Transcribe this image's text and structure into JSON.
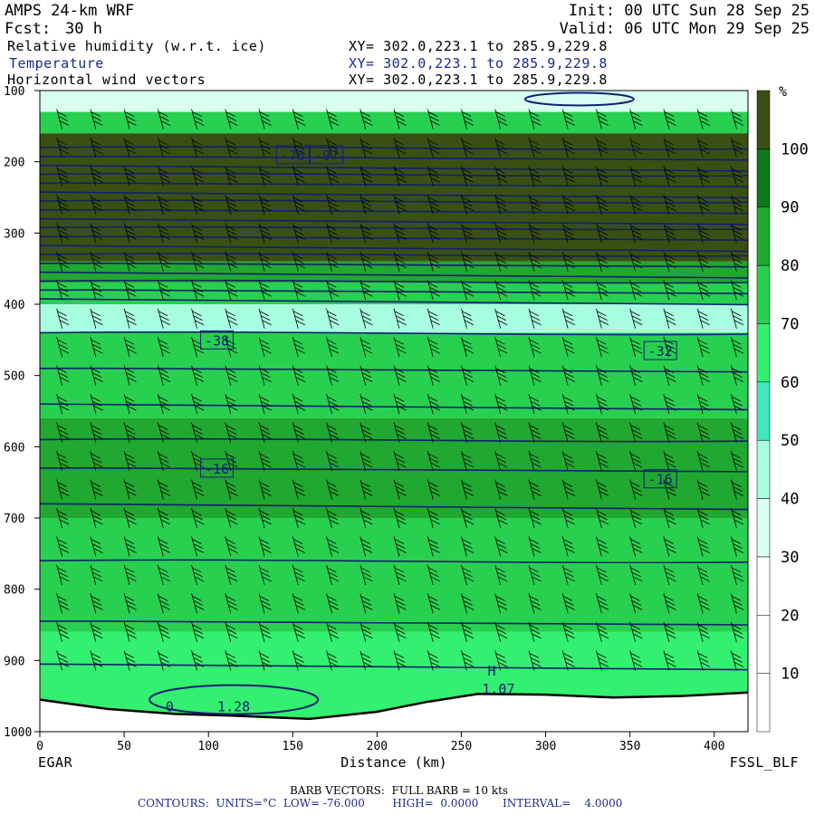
{
  "header": {
    "model": "AMPS 24-km WRF",
    "forecast_label": "Fcst:",
    "forecast_hours": "30 h",
    "init": "Init: 00 UTC Sun 28 Sep 25",
    "valid": "Valid: 06 UTC Mon 29 Sep 25",
    "field_rh": "Relative humidity (w.r.t. ice)",
    "field_temp": "Temperature",
    "field_wind": "Horizontal wind vectors",
    "xy_rh": "XY= 302.0,223.1 to 285.9,229.8",
    "xy_temp": "XY= 302.0,223.1 to 285.9,229.8",
    "xy_wind": "XY= 302.0,223.1 to 285.9,229.8"
  },
  "footer": {
    "left_station": "EGAR",
    "right_station": "FSSL_BLF",
    "barb_note": "BARB VECTORS:  FULL BARB = 10 kts",
    "contour_note": "CONTOURS:  UNITS=°C  LOW= -76.000        HIGH=  0.0000       INTERVAL=    4.0000"
  },
  "colors": {
    "rh_scale": [
      "#ffffff",
      "#ffffff",
      "#ffffff",
      "#d8fff0",
      "#a8ffe0",
      "#40e8c0",
      "#34f070",
      "#28d050",
      "#20a830",
      "#0a7a18",
      "#3a5012"
    ],
    "contour": "#102070",
    "barb": "#000000"
  },
  "chart_data": {
    "type": "heatmap",
    "title": "Relative humidity (w.r.t. ice)",
    "xlabel": "Distance (km)",
    "ylabel": "",
    "x_range": [
      0,
      420
    ],
    "y_range": [
      1000,
      100
    ],
    "y_scale": "linear pressure, inverted",
    "x_ticks": [
      0,
      50,
      100,
      150,
      200,
      250,
      300,
      350,
      400
    ],
    "y_ticks": [
      100,
      200,
      300,
      400,
      500,
      600,
      700,
      800,
      900,
      1000
    ],
    "colorbar": {
      "unit": "%",
      "ticks": [
        10,
        20,
        30,
        40,
        50,
        60,
        70,
        80,
        90,
        100
      ],
      "bounds": [
        0,
        10,
        20,
        30,
        40,
        50,
        60,
        70,
        80,
        90,
        100,
        110
      ]
    },
    "rh_bands": [
      {
        "p_top": 100,
        "p_bot": 130,
        "rh": 30
      },
      {
        "p_top": 130,
        "p_bot": 160,
        "rh": 70
      },
      {
        "p_top": 160,
        "p_bot": 340,
        "rh": 100
      },
      {
        "p_top": 340,
        "p_bot": 370,
        "rh": 80
      },
      {
        "p_top": 370,
        "p_bot": 400,
        "rh": 70
      },
      {
        "p_top": 400,
        "p_bot": 440,
        "rh": 40
      },
      {
        "p_top": 440,
        "p_bot": 560,
        "rh": 70
      },
      {
        "p_top": 560,
        "p_bot": 700,
        "rh": 80
      },
      {
        "p_top": 700,
        "p_bot": 860,
        "rh": 70
      },
      {
        "p_top": 860,
        "p_bot": 1000,
        "rh": 60
      }
    ],
    "temperature_contour_labels": [
      {
        "x": 150,
        "p": 190,
        "label": "-76"
      },
      {
        "x": 170,
        "p": 190,
        "label": "-97"
      },
      {
        "x": 105,
        "p": 450,
        "label": "-38"
      },
      {
        "x": 368,
        "p": 465,
        "label": "-32"
      },
      {
        "x": 105,
        "p": 630,
        "label": "-16"
      },
      {
        "x": 368,
        "p": 645,
        "label": "-16"
      }
    ],
    "terrain_marks": [
      {
        "x": 272,
        "p": 940,
        "label": "1.07"
      },
      {
        "x": 115,
        "p": 965,
        "label": "1.28"
      },
      {
        "x": 77,
        "p": 965,
        "label": "0"
      },
      {
        "x": 268,
        "p": 915,
        "label": "H"
      }
    ],
    "temperature_contour_note": "LOW= -76.000  HIGH= 0.0000  INTERVAL= 4.0000 °C",
    "wind_barbs": "full barb = 10 kts"
  }
}
